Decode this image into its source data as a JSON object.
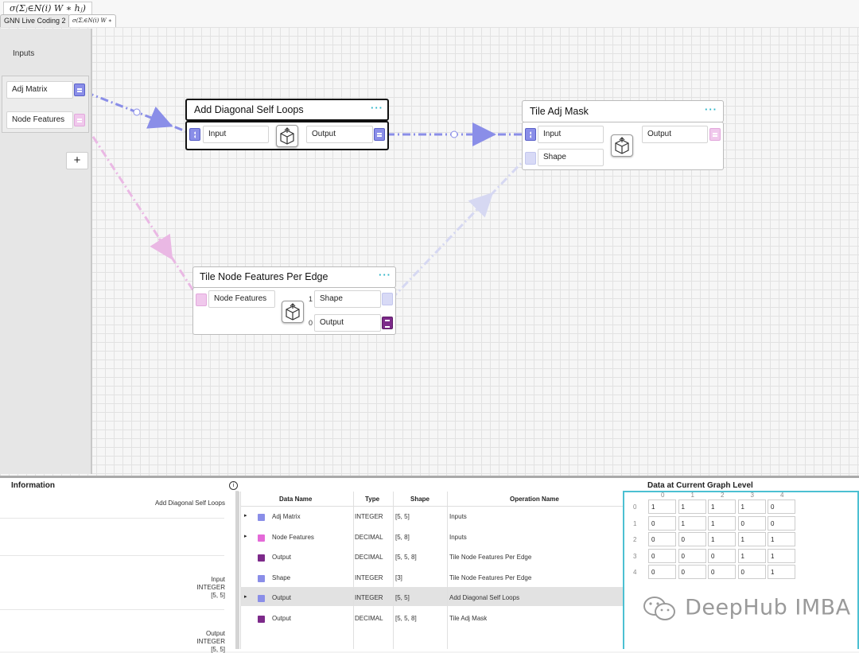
{
  "header": {
    "formula_title": "σ(Σⱼ∈N(i) W ∗ hⱼ)",
    "tabs": [
      "GNN Live Coding 2",
      "σ(Σⱼ∈N(i) W ∗"
    ]
  },
  "inputs_panel": {
    "title": "Inputs",
    "items": [
      {
        "label": "Adj Matrix",
        "port_color": "#8a8ee8"
      },
      {
        "label": "Node Features",
        "port_color": "#f0c8ec"
      }
    ],
    "add_label": "+"
  },
  "nodes": {
    "diag": {
      "title": "Add Diagonal Self Loops",
      "menu": "···",
      "input": "Input",
      "output": "Output"
    },
    "tile_adj": {
      "title": "Tile Adj Mask",
      "menu": "···",
      "input": "Input",
      "shape": "Shape",
      "output": "Output"
    },
    "tile_nf": {
      "title": "Tile Node Features Per Edge",
      "menu": "···",
      "input": "Node Features",
      "shape": "Shape",
      "shape_index": "1",
      "output": "Output",
      "output_index": "0"
    }
  },
  "information": {
    "title": "Information",
    "info_icon": "i",
    "entries": [
      {
        "lines": [
          "Add Diagonal Self Loops"
        ]
      },
      {
        "lines": [
          "Input",
          "INTEGER",
          "[5, 5]"
        ]
      },
      {
        "lines": [
          "Output",
          "INTEGER",
          "[5, 5]"
        ]
      }
    ]
  },
  "data_table": {
    "headers": [
      "Data Name",
      "Type",
      "Shape",
      "Operation Name"
    ],
    "rows": [
      {
        "expand": "▸",
        "icon_color": "#8a8ee8",
        "name": "Adj Matrix",
        "type": "INTEGER",
        "shape": "[5, 5]",
        "op": "Inputs"
      },
      {
        "expand": "▸",
        "icon_color": "#e46ad8",
        "name": "Node Features",
        "type": "DECIMAL",
        "shape": "[5, 8]",
        "op": "Inputs"
      },
      {
        "expand": "",
        "icon_color": "#7d2a8a",
        "name": "Output",
        "type": "DECIMAL",
        "shape": "[5, 5, 8]",
        "op": "Tile Node Features Per Edge"
      },
      {
        "expand": "",
        "icon_color": "#8a8ee8",
        "name": "Shape",
        "type": "INTEGER",
        "shape": "[3]",
        "op": "Tile Node Features Per Edge"
      },
      {
        "expand": "▸",
        "icon_color": "#8a8ee8",
        "name": "Output",
        "type": "INTEGER",
        "shape": "[5, 5]",
        "op": "Add Diagonal Self Loops"
      },
      {
        "expand": "",
        "icon_color": "#7d2a8a",
        "name": "Output",
        "type": "DECIMAL",
        "shape": "[5, 5, 8]",
        "op": "Tile Adj Mask"
      }
    ],
    "selected_row": 4
  },
  "data_level": {
    "title": "Data at Current Graph Level",
    "col_labels": [
      "0",
      "1",
      "2",
      "3",
      "4"
    ],
    "row_labels": [
      "0",
      "1",
      "2",
      "3",
      "4"
    ],
    "matrix": [
      [
        "1",
        "1",
        "1",
        "1",
        "0"
      ],
      [
        "0",
        "1",
        "1",
        "0",
        "0"
      ],
      [
        "0",
        "0",
        "1",
        "1",
        "1"
      ],
      [
        "0",
        "0",
        "0",
        "1",
        "1"
      ],
      [
        "0",
        "0",
        "0",
        "0",
        "1"
      ]
    ]
  },
  "watermark": "DeepHub IMBA",
  "colors": {
    "accent": "#4cc0d2",
    "int_port": "#8a8ee8",
    "dec_port": "#f0c8ec",
    "out_dec": "#7d2a8a"
  }
}
